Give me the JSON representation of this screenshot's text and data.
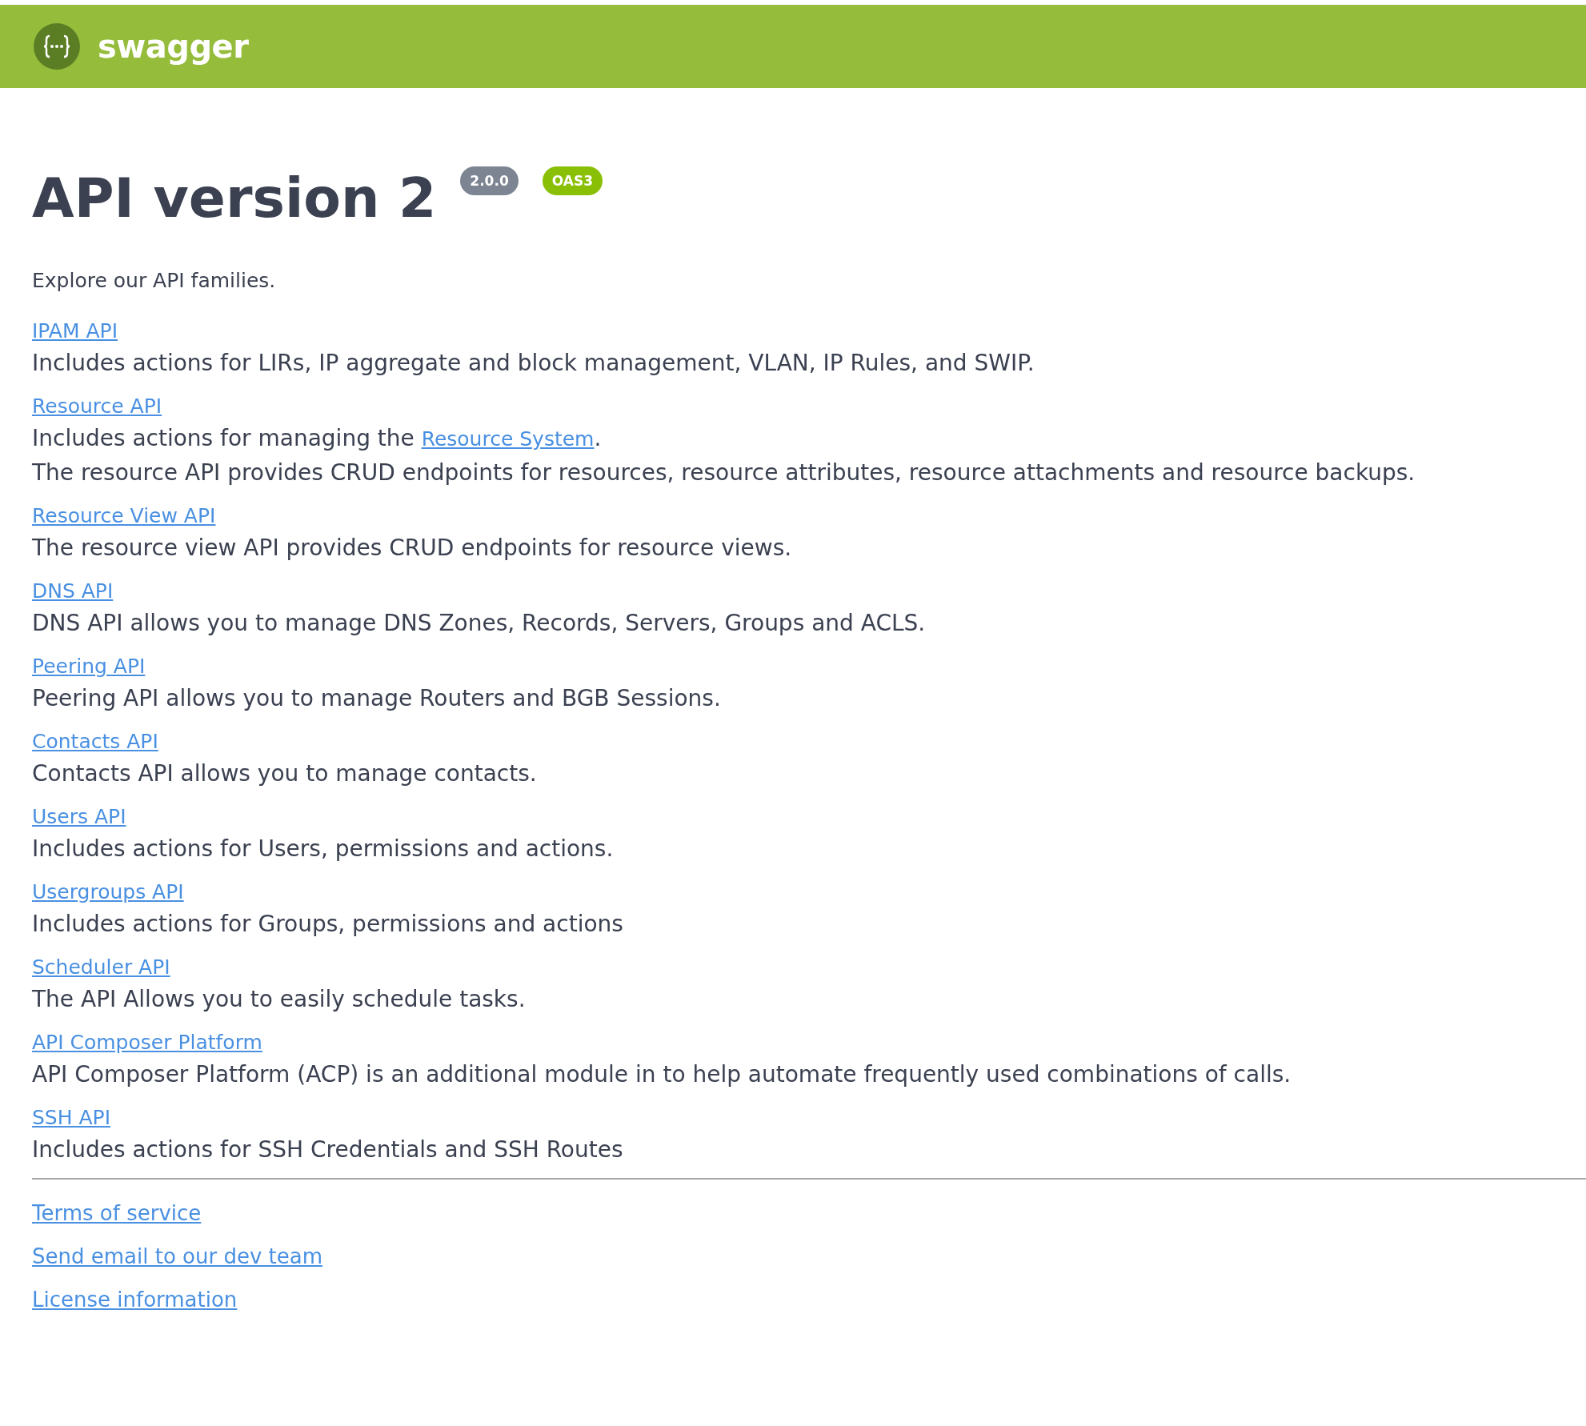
{
  "topbar": {
    "brand": "swagger"
  },
  "title": "API version 2",
  "badges": [
    {
      "label": "2.0.0",
      "color": "#7d8492"
    },
    {
      "label": "OAS3",
      "color": "#89bf04"
    }
  ],
  "intro": "Explore our API families.",
  "apis": [
    {
      "name": "IPAM API",
      "lines": [
        [
          {
            "kind": "text",
            "text": "Includes actions for LIRs, IP aggregate and block management, VLAN, IP Rules, and SWIP."
          }
        ]
      ]
    },
    {
      "name": "Resource API",
      "lines": [
        [
          {
            "kind": "text",
            "text": "Includes actions for managing the "
          },
          {
            "kind": "link",
            "text": "Resource System"
          },
          {
            "kind": "text",
            "text": "."
          }
        ],
        [
          {
            "kind": "text",
            "text": "The resource API provides CRUD endpoints for resources, resource attributes, resource attachments and resource backups."
          }
        ]
      ]
    },
    {
      "name": "Resource View API",
      "lines": [
        [
          {
            "kind": "text",
            "text": "The resource view API provides CRUD endpoints for resource views."
          }
        ]
      ]
    },
    {
      "name": "DNS API",
      "lines": [
        [
          {
            "kind": "text",
            "text": "DNS API allows you to manage DNS Zones, Records, Servers, Groups and ACLS."
          }
        ]
      ]
    },
    {
      "name": "Peering API",
      "lines": [
        [
          {
            "kind": "text",
            "text": "Peering API allows you to manage Routers and BGB Sessions."
          }
        ]
      ]
    },
    {
      "name": "Contacts API",
      "lines": [
        [
          {
            "kind": "text",
            "text": "Contacts API allows you to manage contacts."
          }
        ]
      ]
    },
    {
      "name": "Users API",
      "lines": [
        [
          {
            "kind": "text",
            "text": "Includes actions for Users, permissions and actions."
          }
        ]
      ]
    },
    {
      "name": "Usergroups API",
      "lines": [
        [
          {
            "kind": "text",
            "text": "Includes actions for Groups, permissions and actions"
          }
        ]
      ]
    },
    {
      "name": "Scheduler API",
      "lines": [
        [
          {
            "kind": "text",
            "text": "The API Allows you to easily schedule tasks."
          }
        ]
      ]
    },
    {
      "name": "API Composer Platform",
      "lines": [
        [
          {
            "kind": "text",
            "text": "API Composer Platform (ACP) is an additional module in to help automate frequently used combinations of calls."
          }
        ]
      ]
    },
    {
      "name": "SSH API",
      "lines": [
        [
          {
            "kind": "text",
            "text": "Includes actions for SSH Credentials and SSH Routes"
          }
        ]
      ]
    }
  ],
  "footer_links": [
    "Terms of service",
    "Send email to our dev team",
    "License information"
  ]
}
